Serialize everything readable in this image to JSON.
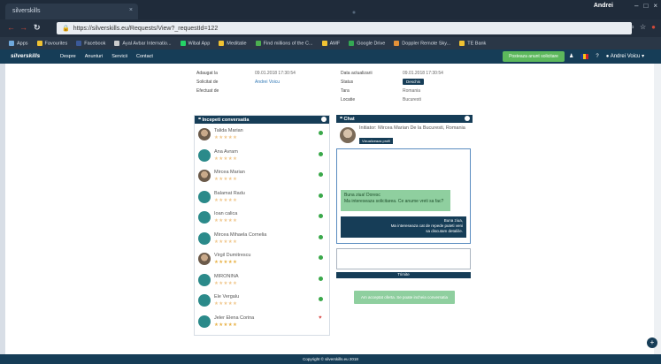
{
  "browser": {
    "tab_title": "silverskills",
    "window_user": "Andrei",
    "url": "https://silverskills.eu/Requests/View?_requestId=122",
    "bookmarks": [
      "Apps",
      "Favourites",
      "Facebook",
      "Ayal Avbar Internatio...",
      "Wibal App",
      "Meditatie",
      "Find millions of the C...",
      "AMF",
      "Google Drive",
      "Doppler Remote Sky...",
      "TE Bank"
    ]
  },
  "site_nav": {
    "logo": "silverskills",
    "menu": [
      "Despre",
      "Anunturi",
      "Servicii",
      "Contact"
    ],
    "cta": "Posteaza anunt solicitare",
    "user": "Andrei Voicu"
  },
  "request_info": {
    "left": [
      {
        "label": "Adaugat la",
        "value": "09.01.2018 17:30:54"
      },
      {
        "label": "Solicitat de",
        "value": "Andrei Voicu"
      },
      {
        "label": "Efectuat de",
        "value": ""
      }
    ],
    "right": [
      {
        "label": "Data actualizarii",
        "value": "09.01.2018 17:30:54"
      },
      {
        "label": "Status",
        "value": "Deschis"
      },
      {
        "label": "Tara",
        "value": "Romania"
      },
      {
        "label": "Locatie",
        "value": "Bucuresti"
      }
    ]
  },
  "conversations": {
    "title": "Incepeti conversatia",
    "people": [
      {
        "name": "Talida Marian",
        "stars": 0
      },
      {
        "name": "Ana Avram",
        "stars": 0
      },
      {
        "name": "Mircea Marian",
        "stars": 0
      },
      {
        "name": "Balamat Radu",
        "stars": 0
      },
      {
        "name": "Ioan calica",
        "stars": 0
      },
      {
        "name": "Mircea Mihaela Cornelia",
        "stars": 0
      },
      {
        "name": "Virgil Dumitrescu",
        "stars": 5
      },
      {
        "name": "MIRONINA",
        "stars": 0
      },
      {
        "name": "Ele Vergalu",
        "stars": 0
      },
      {
        "name": "Jeler Elena Corina",
        "stars": 5
      }
    ]
  },
  "chat": {
    "title": "Chat",
    "header": "Initiator: Mircea Marian De la Bucuresti, Romania",
    "profile_button": "Vizualizeaza profil",
    "message_in": "Buna ziua! Doresc\nMa intereseaza solicitarea. Ce anume vreti sa fac?",
    "message_out": "Buna ziua,\nMa intereseaza cat de repede puteti veni\nsa discutam detaliile.",
    "send_label": "Trimite",
    "end_label": "Am acceptat oferta. Se poate incheia conversatia"
  },
  "footer": "Copyright © silverskills.eu 2018"
}
